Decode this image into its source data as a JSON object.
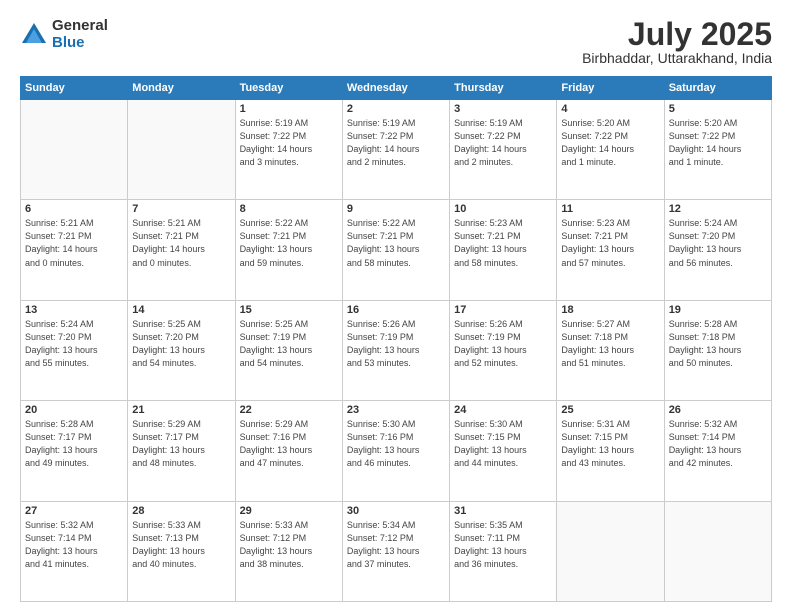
{
  "logo": {
    "general": "General",
    "blue": "Blue"
  },
  "title": {
    "month": "July 2025",
    "location": "Birbhaddar, Uttarakhand, India"
  },
  "headers": [
    "Sunday",
    "Monday",
    "Tuesday",
    "Wednesday",
    "Thursday",
    "Friday",
    "Saturday"
  ],
  "weeks": [
    [
      {
        "day": "",
        "info": ""
      },
      {
        "day": "",
        "info": ""
      },
      {
        "day": "1",
        "info": "Sunrise: 5:19 AM\nSunset: 7:22 PM\nDaylight: 14 hours\nand 3 minutes."
      },
      {
        "day": "2",
        "info": "Sunrise: 5:19 AM\nSunset: 7:22 PM\nDaylight: 14 hours\nand 2 minutes."
      },
      {
        "day": "3",
        "info": "Sunrise: 5:19 AM\nSunset: 7:22 PM\nDaylight: 14 hours\nand 2 minutes."
      },
      {
        "day": "4",
        "info": "Sunrise: 5:20 AM\nSunset: 7:22 PM\nDaylight: 14 hours\nand 1 minute."
      },
      {
        "day": "5",
        "info": "Sunrise: 5:20 AM\nSunset: 7:22 PM\nDaylight: 14 hours\nand 1 minute."
      }
    ],
    [
      {
        "day": "6",
        "info": "Sunrise: 5:21 AM\nSunset: 7:21 PM\nDaylight: 14 hours\nand 0 minutes."
      },
      {
        "day": "7",
        "info": "Sunrise: 5:21 AM\nSunset: 7:21 PM\nDaylight: 14 hours\nand 0 minutes."
      },
      {
        "day": "8",
        "info": "Sunrise: 5:22 AM\nSunset: 7:21 PM\nDaylight: 13 hours\nand 59 minutes."
      },
      {
        "day": "9",
        "info": "Sunrise: 5:22 AM\nSunset: 7:21 PM\nDaylight: 13 hours\nand 58 minutes."
      },
      {
        "day": "10",
        "info": "Sunrise: 5:23 AM\nSunset: 7:21 PM\nDaylight: 13 hours\nand 58 minutes."
      },
      {
        "day": "11",
        "info": "Sunrise: 5:23 AM\nSunset: 7:21 PM\nDaylight: 13 hours\nand 57 minutes."
      },
      {
        "day": "12",
        "info": "Sunrise: 5:24 AM\nSunset: 7:20 PM\nDaylight: 13 hours\nand 56 minutes."
      }
    ],
    [
      {
        "day": "13",
        "info": "Sunrise: 5:24 AM\nSunset: 7:20 PM\nDaylight: 13 hours\nand 55 minutes."
      },
      {
        "day": "14",
        "info": "Sunrise: 5:25 AM\nSunset: 7:20 PM\nDaylight: 13 hours\nand 54 minutes."
      },
      {
        "day": "15",
        "info": "Sunrise: 5:25 AM\nSunset: 7:19 PM\nDaylight: 13 hours\nand 54 minutes."
      },
      {
        "day": "16",
        "info": "Sunrise: 5:26 AM\nSunset: 7:19 PM\nDaylight: 13 hours\nand 53 minutes."
      },
      {
        "day": "17",
        "info": "Sunrise: 5:26 AM\nSunset: 7:19 PM\nDaylight: 13 hours\nand 52 minutes."
      },
      {
        "day": "18",
        "info": "Sunrise: 5:27 AM\nSunset: 7:18 PM\nDaylight: 13 hours\nand 51 minutes."
      },
      {
        "day": "19",
        "info": "Sunrise: 5:28 AM\nSunset: 7:18 PM\nDaylight: 13 hours\nand 50 minutes."
      }
    ],
    [
      {
        "day": "20",
        "info": "Sunrise: 5:28 AM\nSunset: 7:17 PM\nDaylight: 13 hours\nand 49 minutes."
      },
      {
        "day": "21",
        "info": "Sunrise: 5:29 AM\nSunset: 7:17 PM\nDaylight: 13 hours\nand 48 minutes."
      },
      {
        "day": "22",
        "info": "Sunrise: 5:29 AM\nSunset: 7:16 PM\nDaylight: 13 hours\nand 47 minutes."
      },
      {
        "day": "23",
        "info": "Sunrise: 5:30 AM\nSunset: 7:16 PM\nDaylight: 13 hours\nand 46 minutes."
      },
      {
        "day": "24",
        "info": "Sunrise: 5:30 AM\nSunset: 7:15 PM\nDaylight: 13 hours\nand 44 minutes."
      },
      {
        "day": "25",
        "info": "Sunrise: 5:31 AM\nSunset: 7:15 PM\nDaylight: 13 hours\nand 43 minutes."
      },
      {
        "day": "26",
        "info": "Sunrise: 5:32 AM\nSunset: 7:14 PM\nDaylight: 13 hours\nand 42 minutes."
      }
    ],
    [
      {
        "day": "27",
        "info": "Sunrise: 5:32 AM\nSunset: 7:14 PM\nDaylight: 13 hours\nand 41 minutes."
      },
      {
        "day": "28",
        "info": "Sunrise: 5:33 AM\nSunset: 7:13 PM\nDaylight: 13 hours\nand 40 minutes."
      },
      {
        "day": "29",
        "info": "Sunrise: 5:33 AM\nSunset: 7:12 PM\nDaylight: 13 hours\nand 38 minutes."
      },
      {
        "day": "30",
        "info": "Sunrise: 5:34 AM\nSunset: 7:12 PM\nDaylight: 13 hours\nand 37 minutes."
      },
      {
        "day": "31",
        "info": "Sunrise: 5:35 AM\nSunset: 7:11 PM\nDaylight: 13 hours\nand 36 minutes."
      },
      {
        "day": "",
        "info": ""
      },
      {
        "day": "",
        "info": ""
      }
    ]
  ]
}
